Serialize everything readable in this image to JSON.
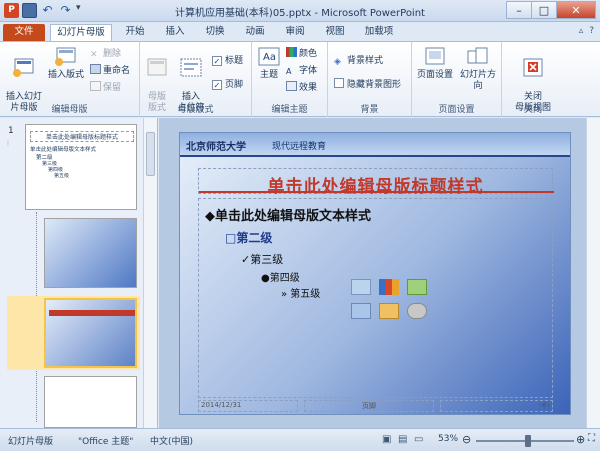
{
  "window": {
    "title": "计算机应用基础(本科)05.pptx - Microsoft PowerPoint",
    "app_icon": "P",
    "controls": [
      "–",
      "□",
      "✕"
    ]
  },
  "tabs": [
    {
      "label": "文件",
      "kind": "file"
    },
    {
      "label": "幻灯片母版",
      "kind": "active"
    },
    {
      "label": "开始"
    },
    {
      "label": "插入"
    },
    {
      "label": "切换"
    },
    {
      "label": "动画"
    },
    {
      "label": "审阅"
    },
    {
      "label": "视图"
    },
    {
      "label": "加载项"
    }
  ],
  "ribbon": {
    "edit_master": {
      "label": "编辑母版",
      "insert_master": "插入幻灯\n片母版",
      "insert_layout": "插入版式",
      "delete": "删除",
      "rename": "重命名",
      "preserve": "保留"
    },
    "master_layout": {
      "label": "母版版式",
      "master_layout_btn": "母版\n版式",
      "insert_placeholder": "插入\n占位符",
      "title_chk": "标题",
      "footer_chk": "页脚"
    },
    "edit_theme": {
      "label": "编辑主题",
      "themes": "主题",
      "colors": "颜色",
      "fonts": "字体",
      "effects": "效果"
    },
    "background": {
      "label": "背景",
      "bg_styles": "背景样式",
      "hide_bg": "隐藏背景图形"
    },
    "page_setup": {
      "label": "页面设置",
      "page_setup_btn": "页面设置",
      "orientation": "幻灯片方向"
    },
    "close": {
      "label": "关闭",
      "close_btn": "关闭\n母版视图"
    }
  },
  "thumbs": {
    "first_number": "1",
    "master_title": "单击此处编辑母版标题样式",
    "master_l1": "单击此处编辑母版文本样式",
    "master_l2": "第二级",
    "master_l3": "第三级",
    "master_l4": "第四级",
    "master_l5": "第五级"
  },
  "slide": {
    "university": "北京师范大学",
    "banner_text": "现代远程教育",
    "title": "单击此处编辑母版标题样式",
    "level1": "◆单击此处编辑母版文本样式",
    "level2": "□第二级",
    "level3": "✓第三级",
    "level4": "●第四级",
    "level5": "» 第五级",
    "footer_date": "2014/12/31",
    "footer_mid": "页脚",
    "footer_num": "‹#›"
  },
  "status": {
    "view": "幻灯片母版",
    "theme": "\"Office 主题\"",
    "language": "中文(中国)",
    "zoom": "53%",
    "zoom_fraction": 0.53
  }
}
